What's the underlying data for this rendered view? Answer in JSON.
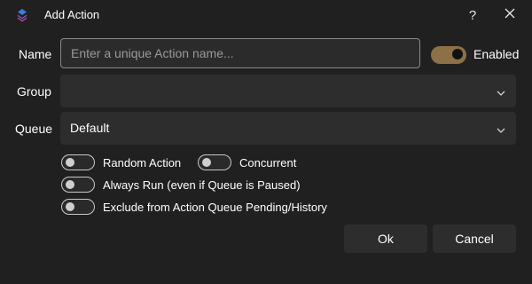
{
  "window": {
    "title": "Add Action",
    "help_glyph": "?"
  },
  "icons": {
    "app": "layered-diamond-icon",
    "help": "question-mark-icon",
    "close": "close-icon",
    "dropdown": "chevron-down-icon"
  },
  "form": {
    "name": {
      "label": "Name",
      "value": "",
      "placeholder": "Enter a unique Action name..."
    },
    "enabled": {
      "label": "Enabled",
      "checked": true
    },
    "group": {
      "label": "Group",
      "value": ""
    },
    "queue": {
      "label": "Queue",
      "value": "Default"
    },
    "options": {
      "random_action": {
        "label": "Random Action",
        "checked": false
      },
      "concurrent": {
        "label": "Concurrent",
        "checked": false
      },
      "always_run": {
        "label": "Always Run (even if Queue is Paused)",
        "checked": false
      },
      "exclude_history": {
        "label": "Exclude from Action Queue Pending/History",
        "checked": false
      }
    }
  },
  "buttons": {
    "ok_label": "Ok",
    "cancel_label": "Cancel"
  },
  "colors": {
    "background": "#202020",
    "field": "#2d2d2d",
    "accent": "#8c7048",
    "icon_blue": "#3d7bd6",
    "icon_purple": "#8a5ad8",
    "icon_pink": "#c84f9a"
  }
}
